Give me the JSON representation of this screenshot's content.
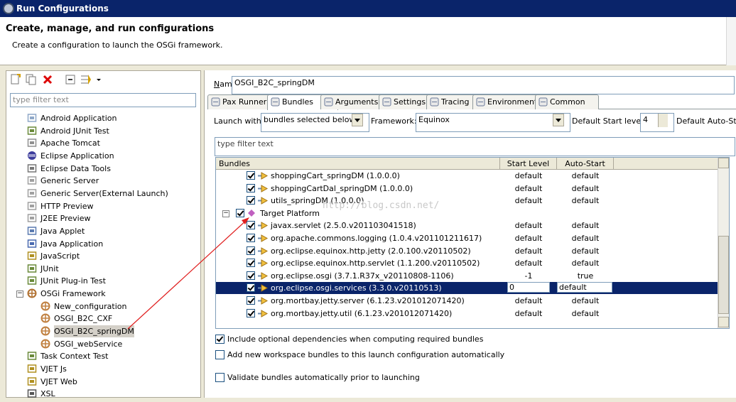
{
  "window": {
    "title": "Run Configurations",
    "icon": "gear-icon"
  },
  "header": {
    "title": "Create, manage, and run configurations",
    "subtitle": "Create a configuration to launch the OSGi framework."
  },
  "left": {
    "toolbar": [
      {
        "name": "new-configuration-icon"
      },
      {
        "name": "duplicate-icon"
      },
      {
        "name": "delete-icon"
      },
      {
        "name": "collapse-all-icon"
      },
      {
        "name": "filter-icon"
      }
    ],
    "filter_placeholder": "type filter text",
    "tree": [
      {
        "label": "Android Application",
        "icon": "android-app-icon",
        "level": 0
      },
      {
        "label": "Android JUnit Test",
        "icon": "junit-icon",
        "level": 0
      },
      {
        "label": "Apache Tomcat",
        "icon": "tomcat-icon",
        "level": 0
      },
      {
        "label": "Eclipse Application",
        "icon": "eclipse-icon",
        "level": 0
      },
      {
        "label": "Eclipse Data Tools",
        "icon": "database-icon",
        "level": 0
      },
      {
        "label": "Generic Server",
        "icon": "server-icon",
        "level": 0
      },
      {
        "label": "Generic Server(External Launch)",
        "icon": "server-icon",
        "level": 0
      },
      {
        "label": "HTTP Preview",
        "icon": "server-icon",
        "level": 0
      },
      {
        "label": "J2EE Preview",
        "icon": "server-icon",
        "level": 0
      },
      {
        "label": "Java Applet",
        "icon": "applet-icon",
        "level": 0
      },
      {
        "label": "Java Application",
        "icon": "java-app-icon",
        "level": 0
      },
      {
        "label": "JavaScript",
        "icon": "javascript-icon",
        "level": 0
      },
      {
        "label": "JUnit",
        "icon": "junit-icon",
        "level": 0
      },
      {
        "label": "JUnit Plug-in Test",
        "icon": "junit-plugin-icon",
        "level": 0
      },
      {
        "label": "OSGi Framework",
        "icon": "osgi-icon",
        "level": 0,
        "expanded": true
      },
      {
        "label": "New_configuration",
        "icon": "osgi-config-icon",
        "level": 1
      },
      {
        "label": "OSGI_B2C_CXF",
        "icon": "osgi-config-icon",
        "level": 1
      },
      {
        "label": "OSGI_B2C_springDM",
        "icon": "osgi-config-icon",
        "level": 1,
        "selected": true
      },
      {
        "label": "OSGI_webService",
        "icon": "osgi-config-icon",
        "level": 1
      },
      {
        "label": "Task Context Test",
        "icon": "task-test-icon",
        "level": 0
      },
      {
        "label": "VJET Js",
        "icon": "vjet-icon",
        "level": 0
      },
      {
        "label": "VJET Web",
        "icon": "vjet-icon",
        "level": 0
      },
      {
        "label": "XSL",
        "icon": "xsl-icon",
        "level": 0
      }
    ]
  },
  "right": {
    "name_label": "Name:",
    "name_value": "OSGI_B2C_springDM",
    "tabs": [
      {
        "label": "Pax Runner",
        "icon": "pax-runner-icon"
      },
      {
        "label": "Bundles",
        "icon": "bundles-icon",
        "active": true
      },
      {
        "label": "Arguments",
        "icon": "arguments-icon"
      },
      {
        "label": "Settings",
        "icon": "settings-icon"
      },
      {
        "label": "Tracing",
        "icon": "tracing-icon"
      },
      {
        "label": "Environment",
        "icon": "environment-icon"
      },
      {
        "label": "Common",
        "icon": "common-icon"
      }
    ],
    "launch_with_label": "Launch with:",
    "launch_with_value": "bundles selected below",
    "framework_label": "Framework:",
    "framework_value": "Equinox",
    "start_level_label": "Default Start level:",
    "start_level_value": "4",
    "auto_start_label": "Default Auto-Start",
    "bundle_filter_placeholder": "type filter text",
    "columns": [
      "Bundles",
      "Start Level",
      "Auto-Start"
    ],
    "rows": [
      {
        "name": "shoppingCart_springDM (1.0.0.0)",
        "level": 2,
        "checked": true,
        "start": "default",
        "auto": "default"
      },
      {
        "name": "shoppingCartDal_springDM (1.0.0.0)",
        "level": 2,
        "checked": true,
        "start": "default",
        "auto": "default"
      },
      {
        "name": "utils_springDM (1.0.0.0)",
        "level": 2,
        "checked": true,
        "start": "default",
        "auto": "default"
      },
      {
        "name": "Target Platform",
        "level": 1,
        "checked": true,
        "group": true,
        "start": "",
        "auto": ""
      },
      {
        "name": "javax.servlet (2.5.0.v201103041518)",
        "level": 2,
        "checked": true,
        "start": "default",
        "auto": "default"
      },
      {
        "name": "org.apache.commons.logging (1.0.4.v201101211617)",
        "level": 2,
        "checked": true,
        "start": "default",
        "auto": "default"
      },
      {
        "name": "org.eclipse.equinox.http.jetty (2.0.100.v20110502)",
        "level": 2,
        "checked": true,
        "start": "default",
        "auto": "default"
      },
      {
        "name": "org.eclipse.equinox.http.servlet (1.1.200.v20110502)",
        "level": 2,
        "checked": true,
        "start": "default",
        "auto": "default"
      },
      {
        "name": "org.eclipse.osgi (3.7.1.R37x_v20110808-1106)",
        "level": 2,
        "checked": true,
        "start": "-1",
        "auto": "true"
      },
      {
        "name": "org.eclipse.osgi.services (3.3.0.v20110513)",
        "level": 2,
        "checked": true,
        "start": "0",
        "auto": "default",
        "selected": true
      },
      {
        "name": "org.mortbay.jetty.server (6.1.23.v201012071420)",
        "level": 2,
        "checked": true,
        "start": "default",
        "auto": "default"
      },
      {
        "name": "org.mortbay.jetty.util (6.1.23.v201012071420)",
        "level": 2,
        "checked": true,
        "start": "default",
        "auto": "default"
      }
    ],
    "watermark": "http://blog.csdn.net/",
    "options": [
      {
        "label": "Include optional dependencies when computing required bundles",
        "checked": true
      },
      {
        "label": "Add new workspace bundles to this launch configuration automatically",
        "checked": false
      },
      {
        "label": "Validate bundles automatically prior to launching",
        "checked": false
      }
    ]
  }
}
